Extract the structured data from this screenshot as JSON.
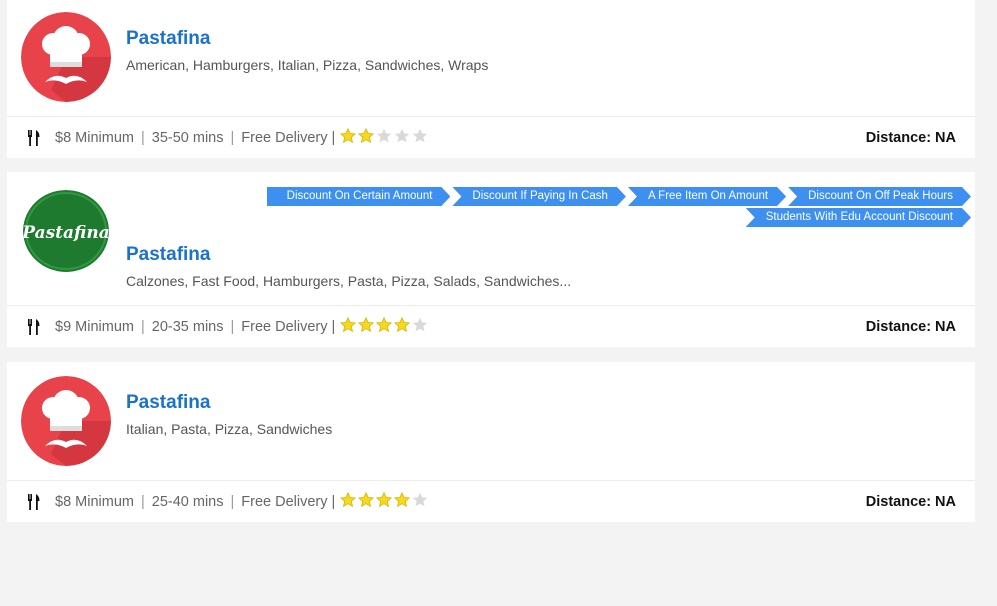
{
  "restaurants": [
    {
      "name": "Pastafina",
      "logo": "chef-hat-mustache-logo",
      "cuisines": "American, Hamburgers, Italian, Pizza, Sandwiches, Wraps",
      "minimum": "$8 Minimum",
      "eta": "35-50 mins",
      "delivery": "Free Delivery |",
      "rating": 2,
      "rating_max": 5,
      "distance": "Distance: NA",
      "offers": []
    },
    {
      "name": "Pastafina",
      "logo": "pastafina-green-logo",
      "logo_text": "Pastafina",
      "cuisines": "Calzones, Fast Food, Hamburgers, Pasta, Pizza, Salads, Sandwiches...",
      "minimum": "$9 Minimum",
      "eta": "20-35 mins",
      "delivery": "Free Delivery |",
      "rating": 4,
      "rating_max": 5,
      "distance": "Distance: NA",
      "offers": [
        "Discount On Certain Amount",
        "Discount If Paying In Cash",
        "A Free Item On Amount",
        "Discount On Off Peak Hours",
        "Students With Edu Account Discount"
      ]
    },
    {
      "name": "Pastafina",
      "logo": "chef-hat-mustache-logo",
      "cuisines": "Italian, Pasta, Pizza, Sandwiches",
      "minimum": "$8 Minimum",
      "eta": "25-40 mins",
      "delivery": "Free Delivery |",
      "rating": 4,
      "rating_max": 5,
      "distance": "Distance: NA",
      "offers": []
    }
  ],
  "colors": {
    "name": "#1a73c9",
    "offer_tag": "#3d8ff0",
    "logo_red": "#e8424a",
    "logo_green": "#1e7a2e",
    "star_filled": "#f5d820",
    "star_empty": "#d9d9d9"
  },
  "icons": {
    "meta": "fork-knife-icon",
    "rating": "star-icon"
  }
}
